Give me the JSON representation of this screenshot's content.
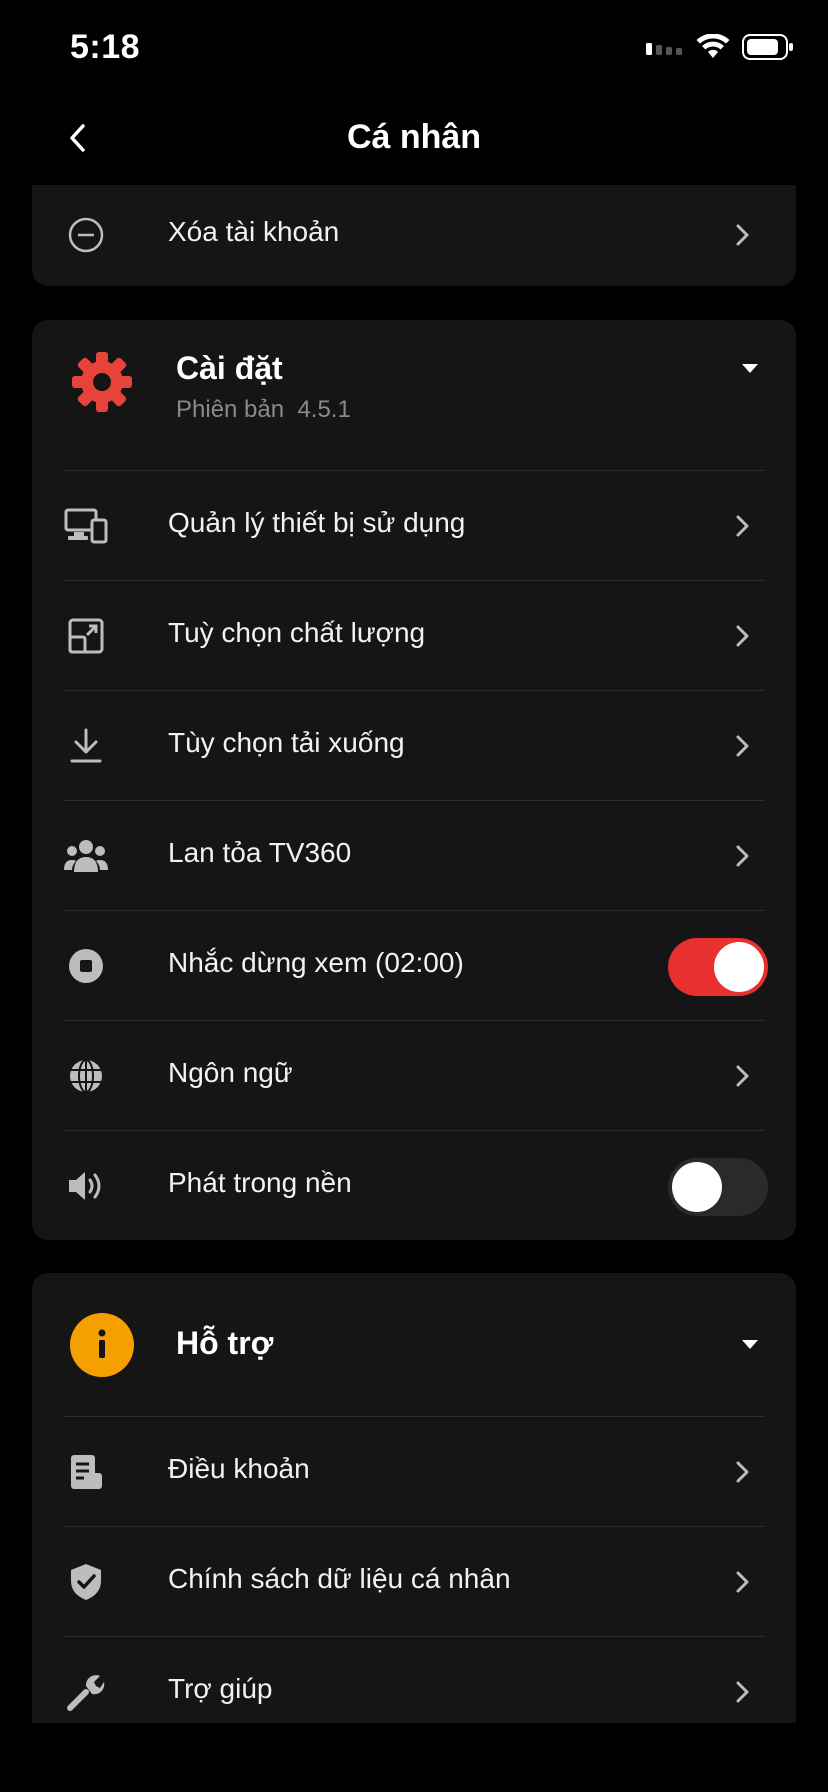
{
  "status": {
    "time": "5:18"
  },
  "header": {
    "title": "Cá nhân"
  },
  "account": {
    "delete_label": "Xóa tài khoản"
  },
  "settings": {
    "title": "Cài đặt",
    "version_label": "Phiên bản",
    "version": "4.5.1",
    "items": [
      {
        "label": "Quản lý thiết bị sử dụng",
        "icon": "devices-icon"
      },
      {
        "label": "Tuỳ chọn chất lượng",
        "icon": "quality-icon"
      },
      {
        "label": "Tùy chọn tải xuống",
        "icon": "download-icon"
      },
      {
        "label": "Lan tỏa TV360",
        "icon": "people-icon"
      },
      {
        "label": "Nhắc dừng xem (02:00)",
        "icon": "stop-circle-icon",
        "toggle": true
      },
      {
        "label": "Ngôn ngữ",
        "icon": "globe-icon"
      },
      {
        "label": "Phát trong nền",
        "icon": "speaker-icon",
        "toggle": false
      }
    ]
  },
  "support": {
    "title": "Hỗ trợ",
    "items": [
      {
        "label": "Điều khoản",
        "icon": "document-icon"
      },
      {
        "label": "Chính sách dữ liệu cá nhân",
        "icon": "shield-check-icon"
      },
      {
        "label": "Trợ giúp",
        "icon": "wrench-icon"
      }
    ]
  },
  "colors": {
    "accent_red": "#e8302f",
    "accent_orange": "#f5a000",
    "card_bg": "#151515"
  }
}
